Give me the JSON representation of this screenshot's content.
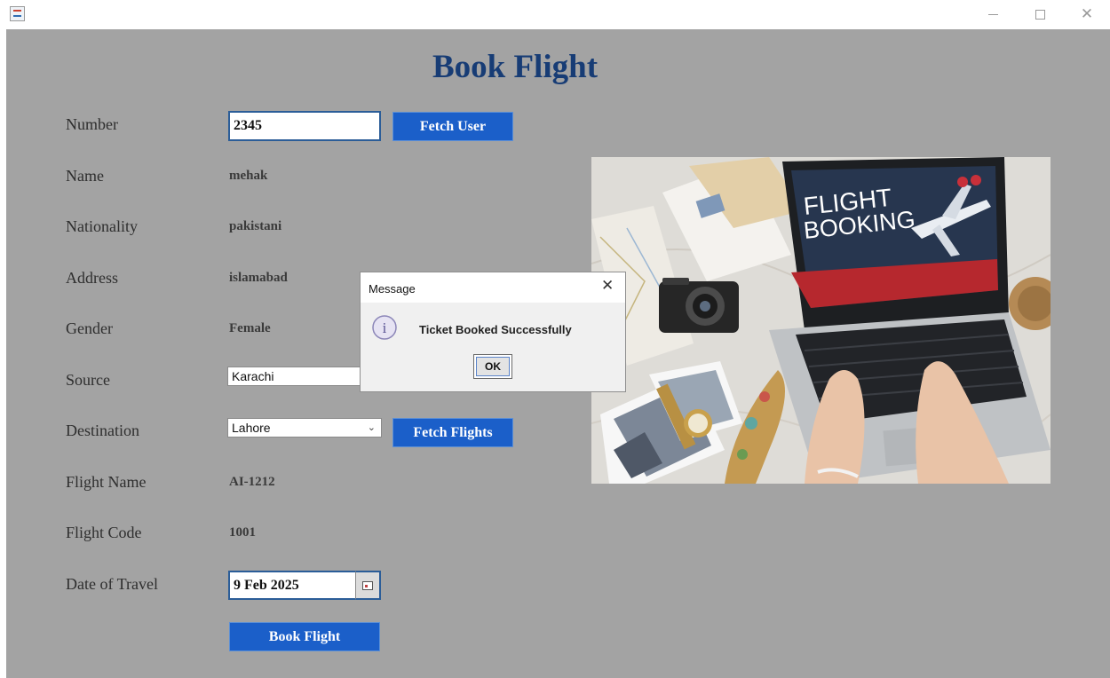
{
  "window": {
    "title_icon": "java-app-icon",
    "minimize_icon": "minimize-icon",
    "maximize_icon": "maximize-icon",
    "close_glyph": "✕"
  },
  "page": {
    "title": "Book Flight"
  },
  "form": {
    "number_label": "Number",
    "number_value": "2345",
    "fetch_user_label": "Fetch User",
    "name_label": "Name",
    "name_value": "mehak",
    "nationality_label": "Nationality",
    "nationality_value": "pakistani",
    "address_label": "Address",
    "address_value": "islamabad",
    "gender_label": "Gender",
    "gender_value": "Female",
    "source_label": "Source",
    "source_value": "Karachi",
    "destination_label": "Destination",
    "destination_value": "Lahore",
    "fetch_flights_label": "Fetch Flights",
    "flight_name_label": "Flight Name",
    "flight_name_value": "AI-1212",
    "flight_code_label": "Flight Code",
    "flight_code_value": "1001",
    "date_label": "Date of Travel",
    "date_value": "9 Feb 2025",
    "book_flight_label": "Book Flight"
  },
  "image": {
    "screen_line1": "FLIGHT",
    "screen_line2": "BOOKING"
  },
  "dialog": {
    "title": "Message",
    "close_glyph": "✕",
    "info_glyph": "i",
    "message": "Ticket Booked Successfully",
    "ok_label": "OK"
  },
  "colors": {
    "panel_bg": "#a3a3a3",
    "title_color": "#173c75",
    "button_blue": "#1b5fc9",
    "input_border": "#2b5d98"
  }
}
